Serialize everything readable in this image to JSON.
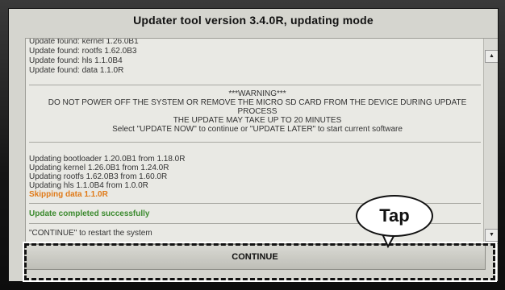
{
  "window": {
    "title": "Updater tool version 3.4.0R, updating mode"
  },
  "log": {
    "found_lines": [
      "Update found: kernel 1.26.0B1",
      "Update found: rootfs 1.62.0B3",
      "Update found: hls 1.1.0B4",
      "Update found: data 1.1.0R"
    ],
    "warning": {
      "heading": "***WARNING***",
      "line1": "DO NOT POWER OFF THE SYSTEM OR REMOVE THE MICRO SD CARD FROM THE DEVICE DURING UPDATE",
      "line2": "PROCESS",
      "line3": "THE UPDATE MAY TAKE UP TO 20 MINUTES",
      "line4": "Select \"UPDATE NOW\" to continue or \"UPDATE LATER\" to start current software"
    },
    "updating_lines": [
      "Updating bootloader 1.20.0B1 from 1.18.0R",
      "Updating kernel 1.26.0B1 from 1.24.0R",
      "Updating rootfs 1.62.0B3 from 1.60.0R",
      "Updating hls 1.1.0B4 from 1.0.0R"
    ],
    "skipping_line": "Skipping data 1.1.0R",
    "completed_line": "Update completed successfully",
    "restart_line": "\"CONTINUE\" to restart the system"
  },
  "scrollbar": {
    "up_glyph": "▲",
    "down_glyph": "▼"
  },
  "buttons": {
    "continue_label": "CONTINUE"
  },
  "annotation": {
    "tap_label": "Tap"
  },
  "colors": {
    "skip": "#e07a18",
    "success": "#3b8a2e",
    "screen_bg": "#d5d5cf"
  }
}
